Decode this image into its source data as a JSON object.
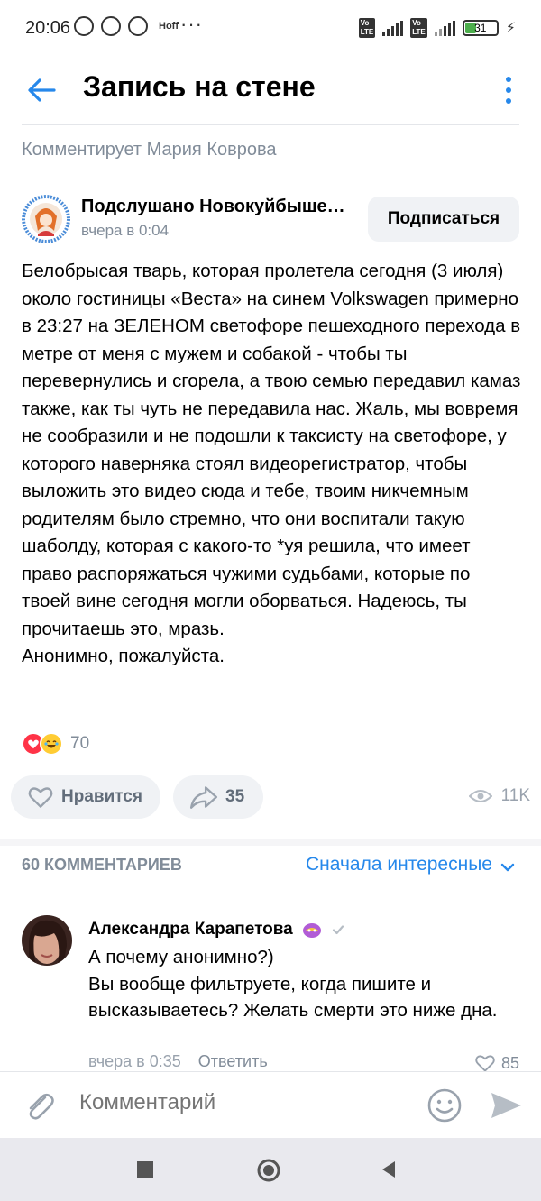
{
  "status_bar": {
    "time": "20:06",
    "battery": "31",
    "network": "4G+",
    "hoff": "Hoff"
  },
  "header": {
    "title": "Запись на стене"
  },
  "commenter_line": "Комментирует Мария Коврова",
  "post": {
    "author": "Подслушано Новокуйбыше…",
    "time": "вчера в 0:04",
    "subscribe_label": "Подписаться",
    "text": "Белобрысая тварь, которая пролетела сегодня (3 июля) около гостиницы «Веста» на синем Volkswagen примерно в 23:27 на ЗЕЛЕНОМ светофоре пешеходного перехода в метре от меня с мужем и собакой - чтобы ты перевернулись и сгорела, а твою семью передавил камаз также, как ты чуть не передавила нас. Жаль, мы вовремя не сообразили и не подошли к таксисту на светофоре, у которого наверняка стоял видеорегистратор, чтобы выложить это видео сюда и тебе, твоим никчемным родителям было стремно, что они воспитали такую шаболду, которая с какого-то *уя решила, что имеет право распоряжаться чужими судьбами, которые по твоей вине сегодня могли оборваться. Надеюсь, ты прочитаешь это, мразь.\nАнонимно, пожалуйста.",
    "reactions_count": "70",
    "like_label": "Нравится",
    "share_count": "35",
    "views": "11K"
  },
  "comments_header": {
    "count_label": "60 КОММЕНТАРИЕВ",
    "sort_label": "Сначала интересные"
  },
  "comment": {
    "author": "Александра Карапетова",
    "text": "А почему анонимно?)\nВы вообще фильтруете, когда пишите и высказываетесь? Желать смерти это ниже дна.",
    "time": "вчера в 0:35",
    "reply_label": "Ответить",
    "likes": "85"
  },
  "input": {
    "placeholder": "Комментарий"
  },
  "colors": {
    "accent": "#2688eb",
    "secondary_text": "#818c99",
    "pill_bg": "#f0f2f5",
    "heart": "#ff3347"
  }
}
